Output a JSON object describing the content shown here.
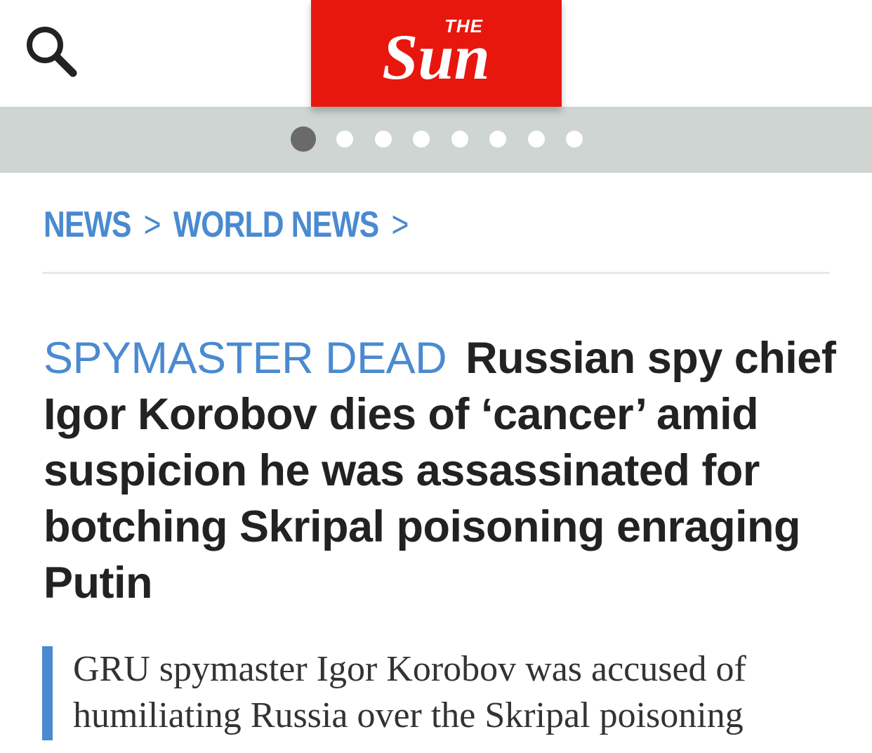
{
  "header": {
    "logo": {
      "text_small": "THE",
      "text_large": "Sun",
      "background": "#e8170e"
    },
    "search_icon": "search-icon"
  },
  "carousel": {
    "dot_count": 8,
    "active_index": 0
  },
  "breadcrumb": {
    "items": [
      "NEWS",
      "WORLD NEWS"
    ],
    "separator": ">"
  },
  "article": {
    "kicker": "SPYMASTER DEAD",
    "headline": "Russian spy chief Igor Korobov dies of ‘cancer’ amid suspicion he was assassinated for botching Skripal poisoning enraging Putin",
    "standfirst": "GRU spymaster Igor Korobov was accused of humiliating Russia over the Skripal poisoning"
  },
  "colors": {
    "accent_blue": "#4a8ad0",
    "brand_red": "#e8170e",
    "carousel_bg": "#cfd5d3",
    "dot_active": "#6a6a6a",
    "dot_inactive": "#ffffff",
    "headline_text": "#222222"
  }
}
